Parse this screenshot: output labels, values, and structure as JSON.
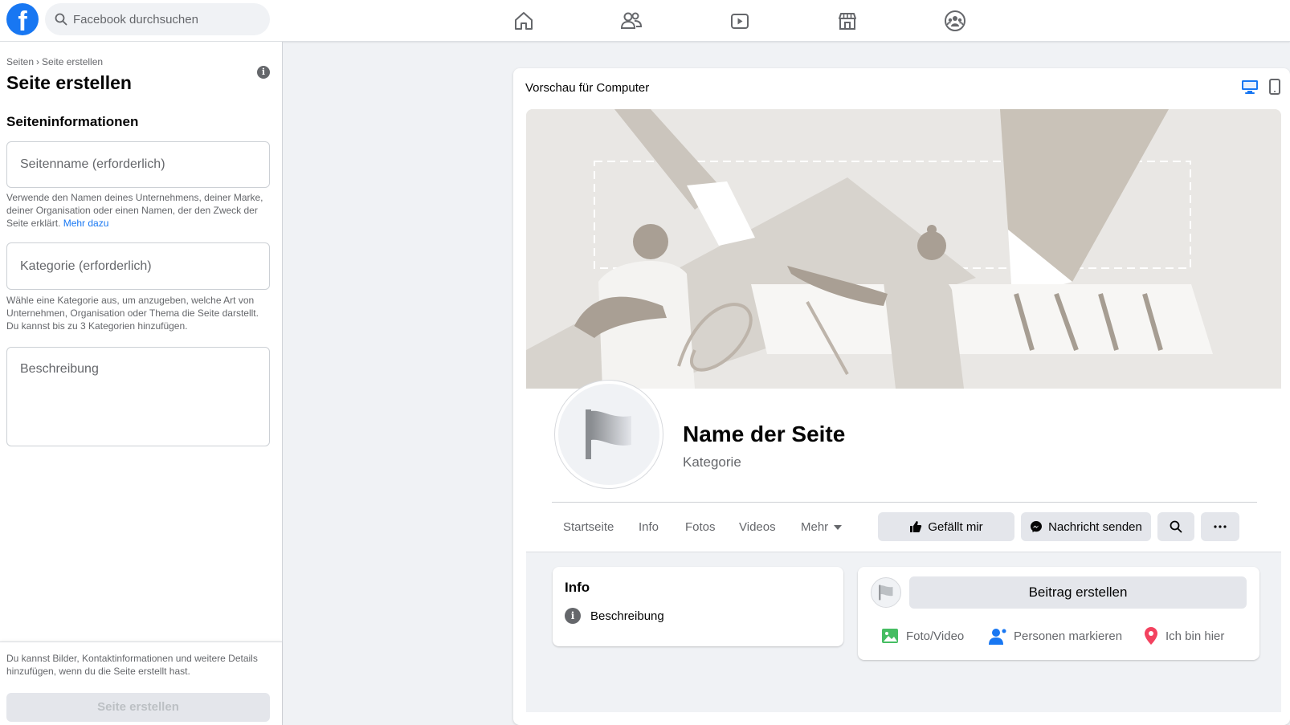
{
  "header": {
    "search_placeholder": "Facebook durchsuchen",
    "nav": [
      "home-icon",
      "friends-icon",
      "watch-icon",
      "marketplace-icon",
      "groups-icon"
    ],
    "brand_color": "#1877f2"
  },
  "left_panel": {
    "breadcrumb_root": "Seiten",
    "breadcrumb_sep": "›",
    "breadcrumb_current": "Seite erstellen",
    "title": "Seite erstellen",
    "section_title": "Seiteninformationen",
    "name_placeholder": "Seitenname (erforderlich)",
    "name_helper": "Verwende den Namen deines Unternehmens, deiner Marke, deiner Organisation oder einen Namen, der den Zweck der Seite erklärt.",
    "name_helper_link": "Mehr dazu",
    "category_placeholder": "Kategorie (erforderlich)",
    "category_helper": "Wähle eine Kategorie aus, um anzugeben, welche Art von Unternehmen, Organisation oder Thema die Seite darstellt. Du kannst bis zu 3 Kategorien hinzufügen.",
    "description_placeholder": "Beschreibung",
    "footer_note": "Du kannst Bilder, Kontaktinformationen und weitere Details hinzufügen, wenn du die Seite erstellt hast.",
    "create_button": "Seite erstellen"
  },
  "preview": {
    "title": "Vorschau für Computer",
    "page_name": "Name der Seite",
    "page_category": "Kategorie",
    "tabs": [
      "Startseite",
      "Info",
      "Fotos",
      "Videos",
      "Mehr"
    ],
    "like_button": "Gefällt mir",
    "message_button": "Nachricht senden",
    "info_card": {
      "title": "Info",
      "description": "Beschreibung"
    },
    "post_card": {
      "create_post": "Beitrag erstellen",
      "photo_video": "Foto/Video",
      "tag_people": "Personen markieren",
      "check_in": "Ich bin hier"
    }
  }
}
